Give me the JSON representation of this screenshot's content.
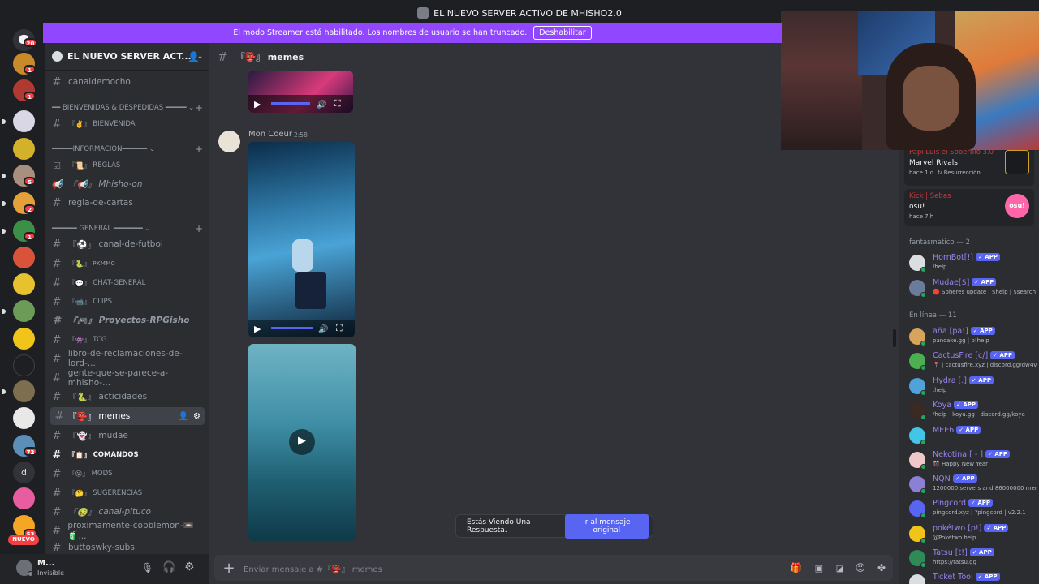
{
  "titlebar": {
    "title": "EL NUEVO SERVER ACTIVO DE MHISHO2.0"
  },
  "banner": {
    "text": "El modo Streamer está habilitado. Los nombres de usuario se han truncado.",
    "button": "Deshabilitar"
  },
  "guilds": {
    "dm_badge": "20",
    "badges": [
      "1",
      "1",
      "5",
      "2",
      "1",
      "72",
      "53"
    ],
    "letter_icon": "d",
    "new_label": "NUEVO"
  },
  "server": {
    "name": "EL NUEVO SERVER ACT..."
  },
  "channels": {
    "canaldemocho": "canaldemocho",
    "cat_bienvenidas": "━━ BIENVENIDAS & DESPEDIDAS ━━━━━",
    "bienvenida": "BIENVENIDA",
    "bienvenida_emoji": "『✌️』",
    "cat_info": "━━━━━INFORMACIÓN━━━━━━",
    "reglas": "REGLAS",
    "reglas_emoji": "『📜』",
    "mhisho_on": "Mhisho-on",
    "mhisho_on_emoji": "『📢』",
    "regla_de_cartas": "regla-de-cartas",
    "cat_general": "━━━━━━ GENERAL ━━━━━━━",
    "canal_de_futbol": "canal-de-futbol",
    "canal_de_futbol_emoji": "『⚽』",
    "pkmmo": "ᴘᴋᴍᴍᴏ",
    "pkmmo_emoji": "『🐍』",
    "chat_general": "CHAT-GENERAL",
    "chat_general_emoji": "『💬』",
    "clips": "CLIPS",
    "clips_emoji": "『📹』",
    "proyectos": "Proyectos-RPGisho",
    "proyectos_emoji": "『🎮』",
    "tcg": "TCG",
    "tcg_emoji": "『👾』",
    "libro": "libro-de-reclamaciones-de-lord-...",
    "gente": "gente-que-se-parece-a-mhisho-...",
    "actividades": "acticidades",
    "actividades_emoji": "『🐍』",
    "memes": "memes",
    "memes_emoji": "『👺』",
    "mudae": "mudae",
    "mudae_emoji": "『👻』",
    "comandos": "COMANDOS",
    "comandos_emoji": "『📋』",
    "mods": "MODS",
    "mods_emoji": "『😵』",
    "sugerencias": "SUGERENCIAS",
    "sugerencias_emoji": "『🤔』",
    "canal_pituco": "canal-pituco",
    "canal_pituco_emoji": "『🤢』",
    "proximamente": "proximamente-cobblemon-📼🧃...",
    "buttoswky": "buttoswky-subs"
  },
  "user": {
    "name": "M...",
    "status": "Invisible"
  },
  "chat": {
    "channel_emoji": "『👺』",
    "channel_name": "memes",
    "message_author": "Mon Coeur",
    "message_time": "2:58",
    "composer_prefix": "Enviar mensaje a #",
    "composer_emoji": "『👺』",
    "composer_channel": "memes"
  },
  "toast": {
    "text": "Estás Viendo Una Respuesta.",
    "button": "Ir al mensaje original"
  },
  "members": {
    "activity1": {
      "name": "Papi Luis el Soberbio 3.0",
      "game": "Marvel Rivals",
      "time": "hace 1 d",
      "extra": "Resurrección"
    },
    "activity2": {
      "name": "Kick | Sebas",
      "game": "osu!",
      "time": "hace 7 h",
      "icon_text": "osu!"
    },
    "group1": "fantasmatico — 2",
    "group2": "En línea — 11",
    "app_tag": "✓ APP",
    "list": [
      {
        "name": "HornBot[!]",
        "status": "/help",
        "color": "#9b84ee"
      },
      {
        "name": "Mudae[$]",
        "status": "🔴 Spheres update | $help | $search",
        "color": "#9b84ee"
      },
      {
        "name": "aña [pa!]",
        "status": "pancake.gg | p!help",
        "color": "#9b84ee"
      },
      {
        "name": "CactusFire [c/]",
        "status": "📍 | cactusfire.xyz | discord.gg/dw4v",
        "color": "#9b84ee"
      },
      {
        "name": "Hydra [.]",
        "status": ".help",
        "color": "#9b84ee"
      },
      {
        "name": "Koya",
        "status": "/help · koya.gg · discord.gg/koya",
        "color": "#9b84ee"
      },
      {
        "name": "MEE6",
        "status": "",
        "color": "#9b84ee"
      },
      {
        "name": "Nekotina [ - ]",
        "status": "🎊 Happy New Year!",
        "color": "#9b84ee"
      },
      {
        "name": "NQN",
        "status": "1200000 servers and 86000000 mer",
        "color": "#9b84ee"
      },
      {
        "name": "Pingcord",
        "status": "pingcord.xyz | ?pingcord | v2.2.1",
        "color": "#9b84ee"
      },
      {
        "name": "pokétwo [p!]",
        "status": "@Pokétwo help",
        "color": "#9b84ee"
      },
      {
        "name": "Tatsu [t!]",
        "status": "https://tatsu.gg",
        "color": "#9b84ee"
      },
      {
        "name": "Ticket Tool",
        "status": "",
        "color": "#9b84ee"
      }
    ]
  }
}
